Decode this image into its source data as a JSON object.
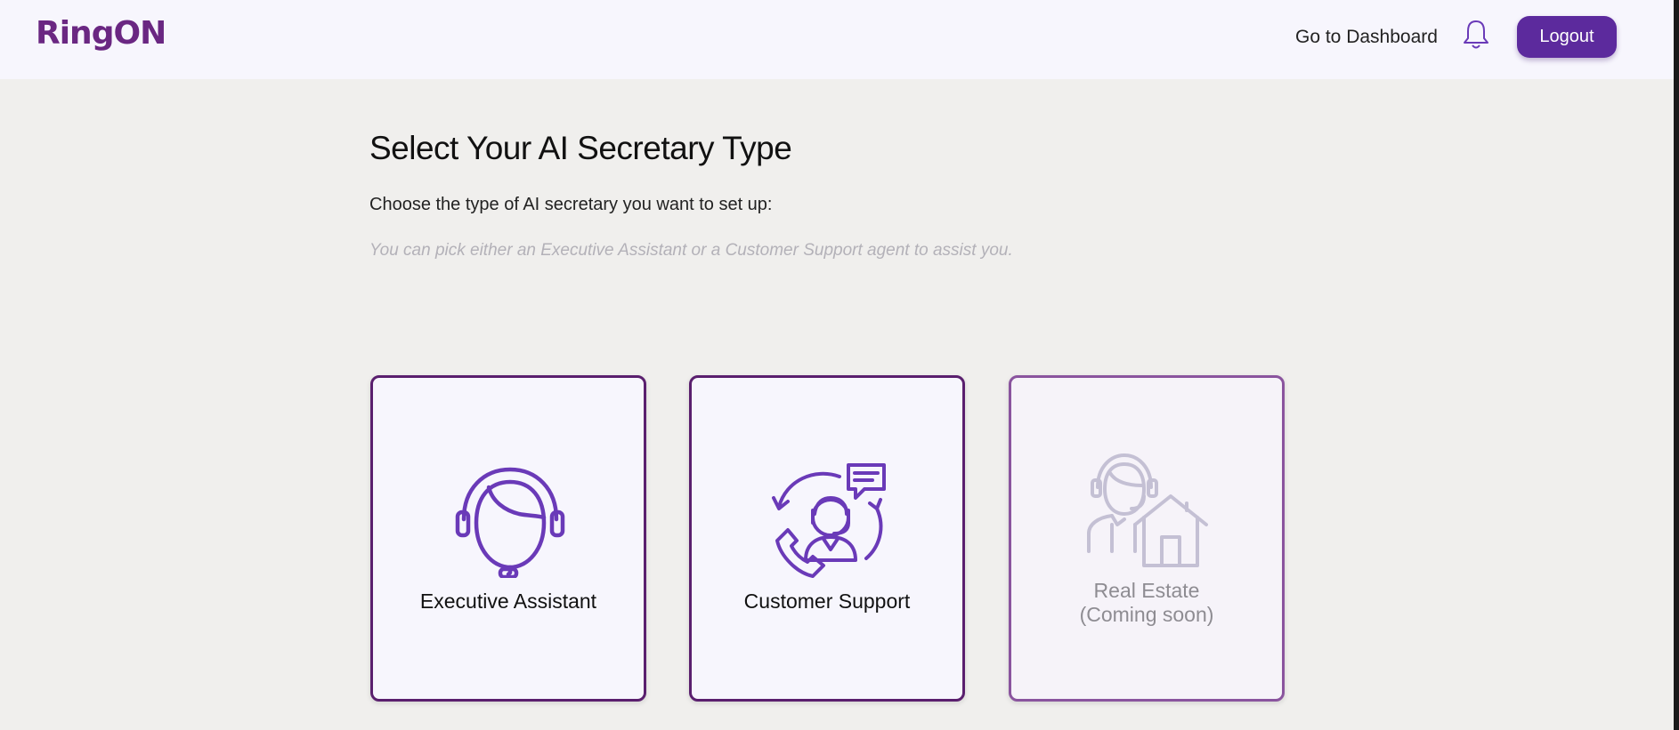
{
  "header": {
    "logo_text": "RingON",
    "nav_link": "Go to Dashboard",
    "bell_icon": "bell-icon",
    "logout_label": "Logout"
  },
  "main": {
    "title": "Select Your AI Secretary Type",
    "subtitle": "Choose the type of AI secretary you want to set up:",
    "hint": "You can pick either an Executive Assistant or a Customer Support agent to assist you."
  },
  "cards": [
    {
      "label": "Executive Assistant",
      "icon": "headset-woman-icon",
      "enabled": true
    },
    {
      "label": "Customer Support",
      "icon": "customer-support-icon",
      "enabled": true
    },
    {
      "label": "Real Estate",
      "sublabel": "(Coming soon)",
      "icon": "real-estate-agent-icon",
      "enabled": false
    }
  ],
  "colors": {
    "brand": "#6a2782",
    "accent": "#5c2a9d",
    "icon": "#6a3ab8",
    "icon_disabled": "#c4c0d4",
    "background": "#f0efed",
    "header_bg": "#f7f6fd"
  }
}
